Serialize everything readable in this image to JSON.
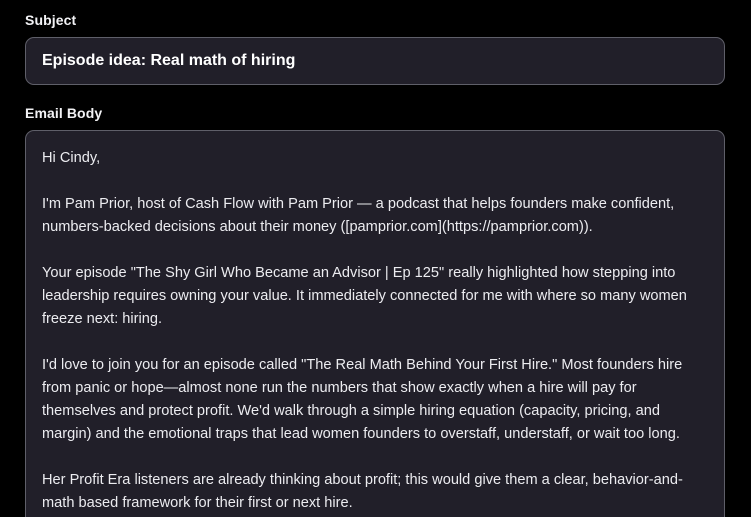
{
  "subject": {
    "label": "Subject",
    "value": "Episode idea: Real math of hiring"
  },
  "email_body": {
    "label": "Email Body",
    "paragraphs": [
      "Hi Cindy,",
      "I'm Pam Prior, host of Cash Flow with Pam Prior — a podcast that helps founders make confident, numbers-backed decisions about their money ([pamprior.com](https://pamprior.com)).",
      "Your episode \"The Shy Girl Who Became an Advisor | Ep 125\" really highlighted how stepping into leadership requires owning your value. It immediately connected for me with where so many women freeze next: hiring.",
      "I'd love to join you for an episode called \"The Real Math Behind Your First Hire.\" Most founders hire from panic or hope—almost none run the numbers that show exactly when a hire will pay for themselves and protect profit. We'd walk through a simple hiring equation (capacity, pricing, and margin) and the emotional traps that lead women founders to overstaff, understaff, or wait too long.",
      "Her Profit Era listeners are already thinking about profit; this would give them a clear, behavior-and-math based framework for their first or next hire."
    ]
  },
  "colors": {
    "page_background": "#000000",
    "field_background": "#211f29",
    "field_border": "#5f5f69",
    "text": "#ececf0"
  }
}
